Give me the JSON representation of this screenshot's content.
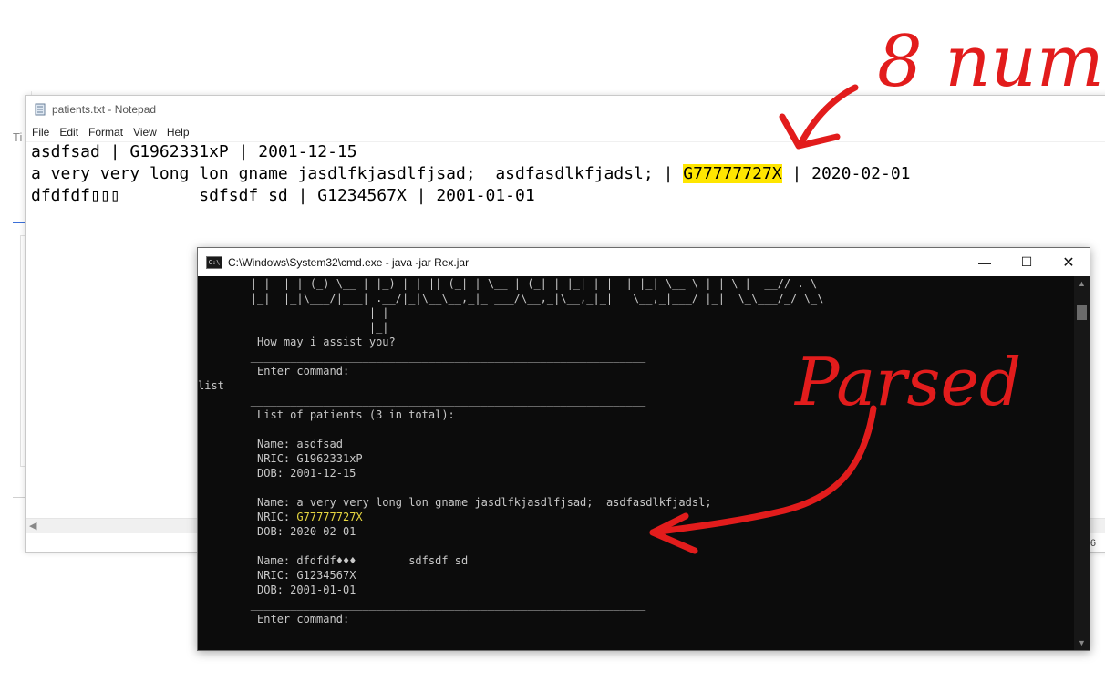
{
  "background": {
    "partial_title": "Ti"
  },
  "notepad": {
    "title": "patients.txt - Notepad",
    "menu": [
      "File",
      "Edit",
      "Format",
      "View",
      "Help"
    ],
    "lines": [
      {
        "before": "asdfsad | G1962331xP | 2001-12-15",
        "highlight": "",
        "after": ""
      },
      {
        "before": "a very very long lon gname jasdlfkjasdlfjsad;  asdfasdlkfjadsl; | ",
        "highlight": "G77777727X",
        "after": " | 2020-02-01"
      },
      {
        "before": "dfdfdf▯▯▯        sdfsdf sd | G1234567X | 2001-01-01",
        "highlight": "",
        "after": ""
      }
    ],
    "status_partial": "86"
  },
  "cmd": {
    "title": "C:\\Windows\\System32\\cmd.exe - java  -jar Rex.jar",
    "ascii_art": [
      "        | |  | | (_) \\__ | |_) | | || (_| | \\__ | (_| | |_| | |  | |_| \\__ \\ | | \\ |  __// . \\",
      "        |_|  |_|\\___/|___| .__/|_|\\__\\__,_|_|___/\\__,_|\\__,_|_|   \\__,_|___/ |_|  \\_\\___/_/ \\_\\",
      "                          | |",
      "                          |_|"
    ],
    "greeting": "How may i assist you?",
    "separator": "____________________________________________________________",
    "prompt": "Enter command:",
    "user_input": "list",
    "list_header": "List of patients (3 in total):",
    "patients": [
      {
        "name_label": "Name: ",
        "name": "asdfsad",
        "nric_label": "NRIC: ",
        "nric": "G1962331xP",
        "dob_label": "DOB: ",
        "dob": "2001-12-15"
      },
      {
        "name_label": "Name: ",
        "name": "a very very long lon gname jasdlfkjasdlfjsad;  asdfasdlkfjadsl;",
        "nric_label": "NRIC: ",
        "nric": "G77777727X",
        "dob_label": "DOB: ",
        "dob": "2020-02-01"
      },
      {
        "name_label": "Name: ",
        "name": "dfdfdf♦♦♦        sdfsdf sd",
        "nric_label": "NRIC: ",
        "nric": "G1234567X",
        "dob_label": "DOB: ",
        "dob": "2001-01-01"
      }
    ],
    "final_prompt": "Enter command:"
  },
  "annotations": {
    "top_note": "8 num",
    "parsed_note": "Parsed",
    "color": "#e21c1c"
  }
}
